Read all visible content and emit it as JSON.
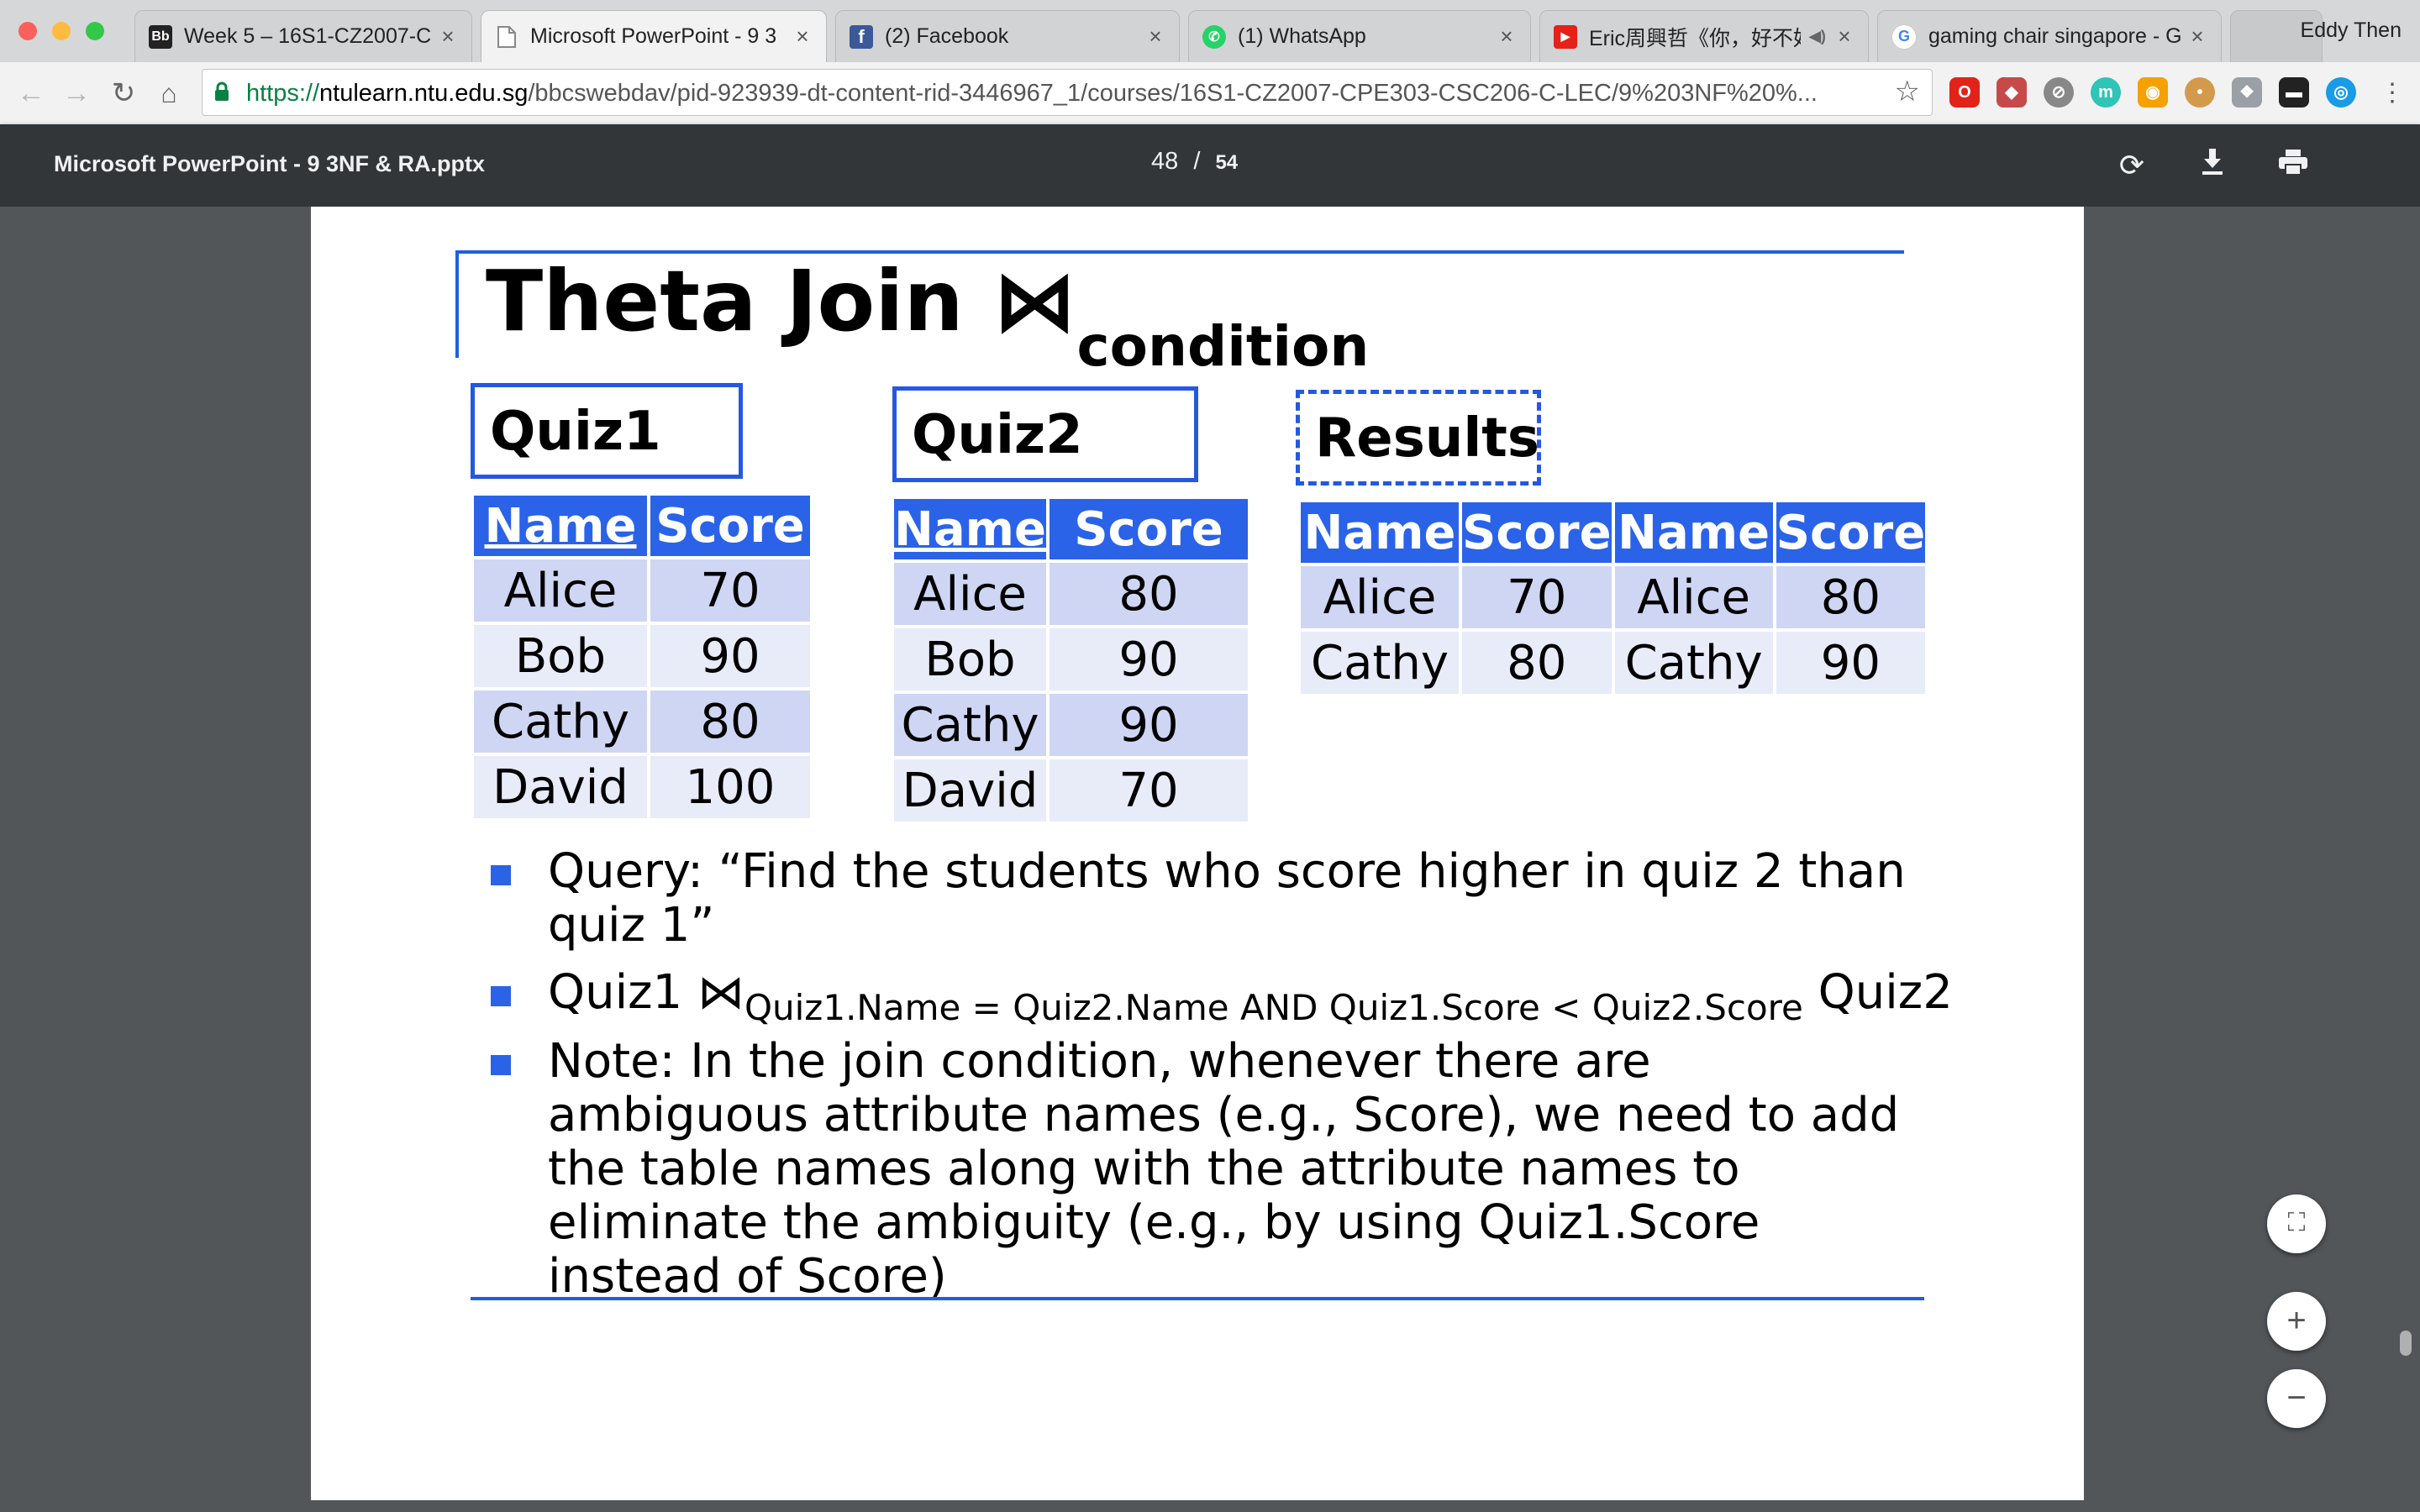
{
  "browser": {
    "tabs": [
      {
        "label": "Week 5 – 16S1-CZ2007-C",
        "icon": "blackboard-icon"
      },
      {
        "label": "Microsoft PowerPoint - 9 3",
        "icon": "document-icon",
        "active": true
      },
      {
        "label": "(2) Facebook",
        "icon": "facebook-icon"
      },
      {
        "label": "(1) WhatsApp",
        "icon": "whatsapp-icon"
      },
      {
        "label": "Eric周興哲《你，好不好",
        "icon": "youtube-icon"
      },
      {
        "label": "gaming chair singapore - G",
        "icon": "google-icon"
      }
    ],
    "profile_name": "Eddy Then",
    "url_scheme": "https://",
    "url_domain": "ntulearn.ntu.edu.sg",
    "url_path": "/bbcswebdav/pid-923939-dt-content-rid-3446967_1/courses/16S1-CZ2007-CPE303-CSC206-C-LEC/9%203NF%20%..."
  },
  "pdf_viewer": {
    "title": "Microsoft PowerPoint - 9 3NF & RA.pptx",
    "current_page": "48",
    "page_sep": "/",
    "total_pages": "54"
  },
  "slide": {
    "title_main": "Theta Join ⋈",
    "title_sub": "condition",
    "quiz1": {
      "label": "Quiz1",
      "headers": [
        "Name",
        "Score"
      ],
      "rows": [
        [
          "Alice",
          "70"
        ],
        [
          "Bob",
          "90"
        ],
        [
          "Cathy",
          "80"
        ],
        [
          "David",
          "100"
        ]
      ]
    },
    "quiz2": {
      "label": "Quiz2",
      "headers": [
        "Name",
        "Score"
      ],
      "rows": [
        [
          "Alice",
          "80"
        ],
        [
          "Bob",
          "90"
        ],
        [
          "Cathy",
          "90"
        ],
        [
          "David",
          "70"
        ]
      ]
    },
    "results": {
      "label": "Results",
      "headers": [
        "Name",
        "Score",
        "Name",
        "Score"
      ],
      "rows": [
        [
          "Alice",
          "70",
          "Alice",
          "80"
        ],
        [
          "Cathy",
          "80",
          "Cathy",
          "90"
        ]
      ]
    },
    "bullets": {
      "b1": "Query: “Find the students who score higher in quiz 2 than quiz 1”",
      "b2_pre": "Quiz1 ⋈",
      "b2_sub": "Quiz1.Name = Quiz2.Name AND Quiz1.Score < Quiz2.Score",
      "b2_post": " Quiz2",
      "b3": "Note: In the join condition, whenever there are ambiguous attribute names (e.g., Score), we need to add the table names along with the attribute names to eliminate the ambiguity (e.g., by using Quiz1.Score instead of Score)"
    }
  },
  "colors": {
    "accent": "#2a63e8",
    "row_odd": "#cfd6f4",
    "row_even": "#e8ebf8",
    "pdf_toolbar": "#323639",
    "viewer_bg": "#525659"
  }
}
